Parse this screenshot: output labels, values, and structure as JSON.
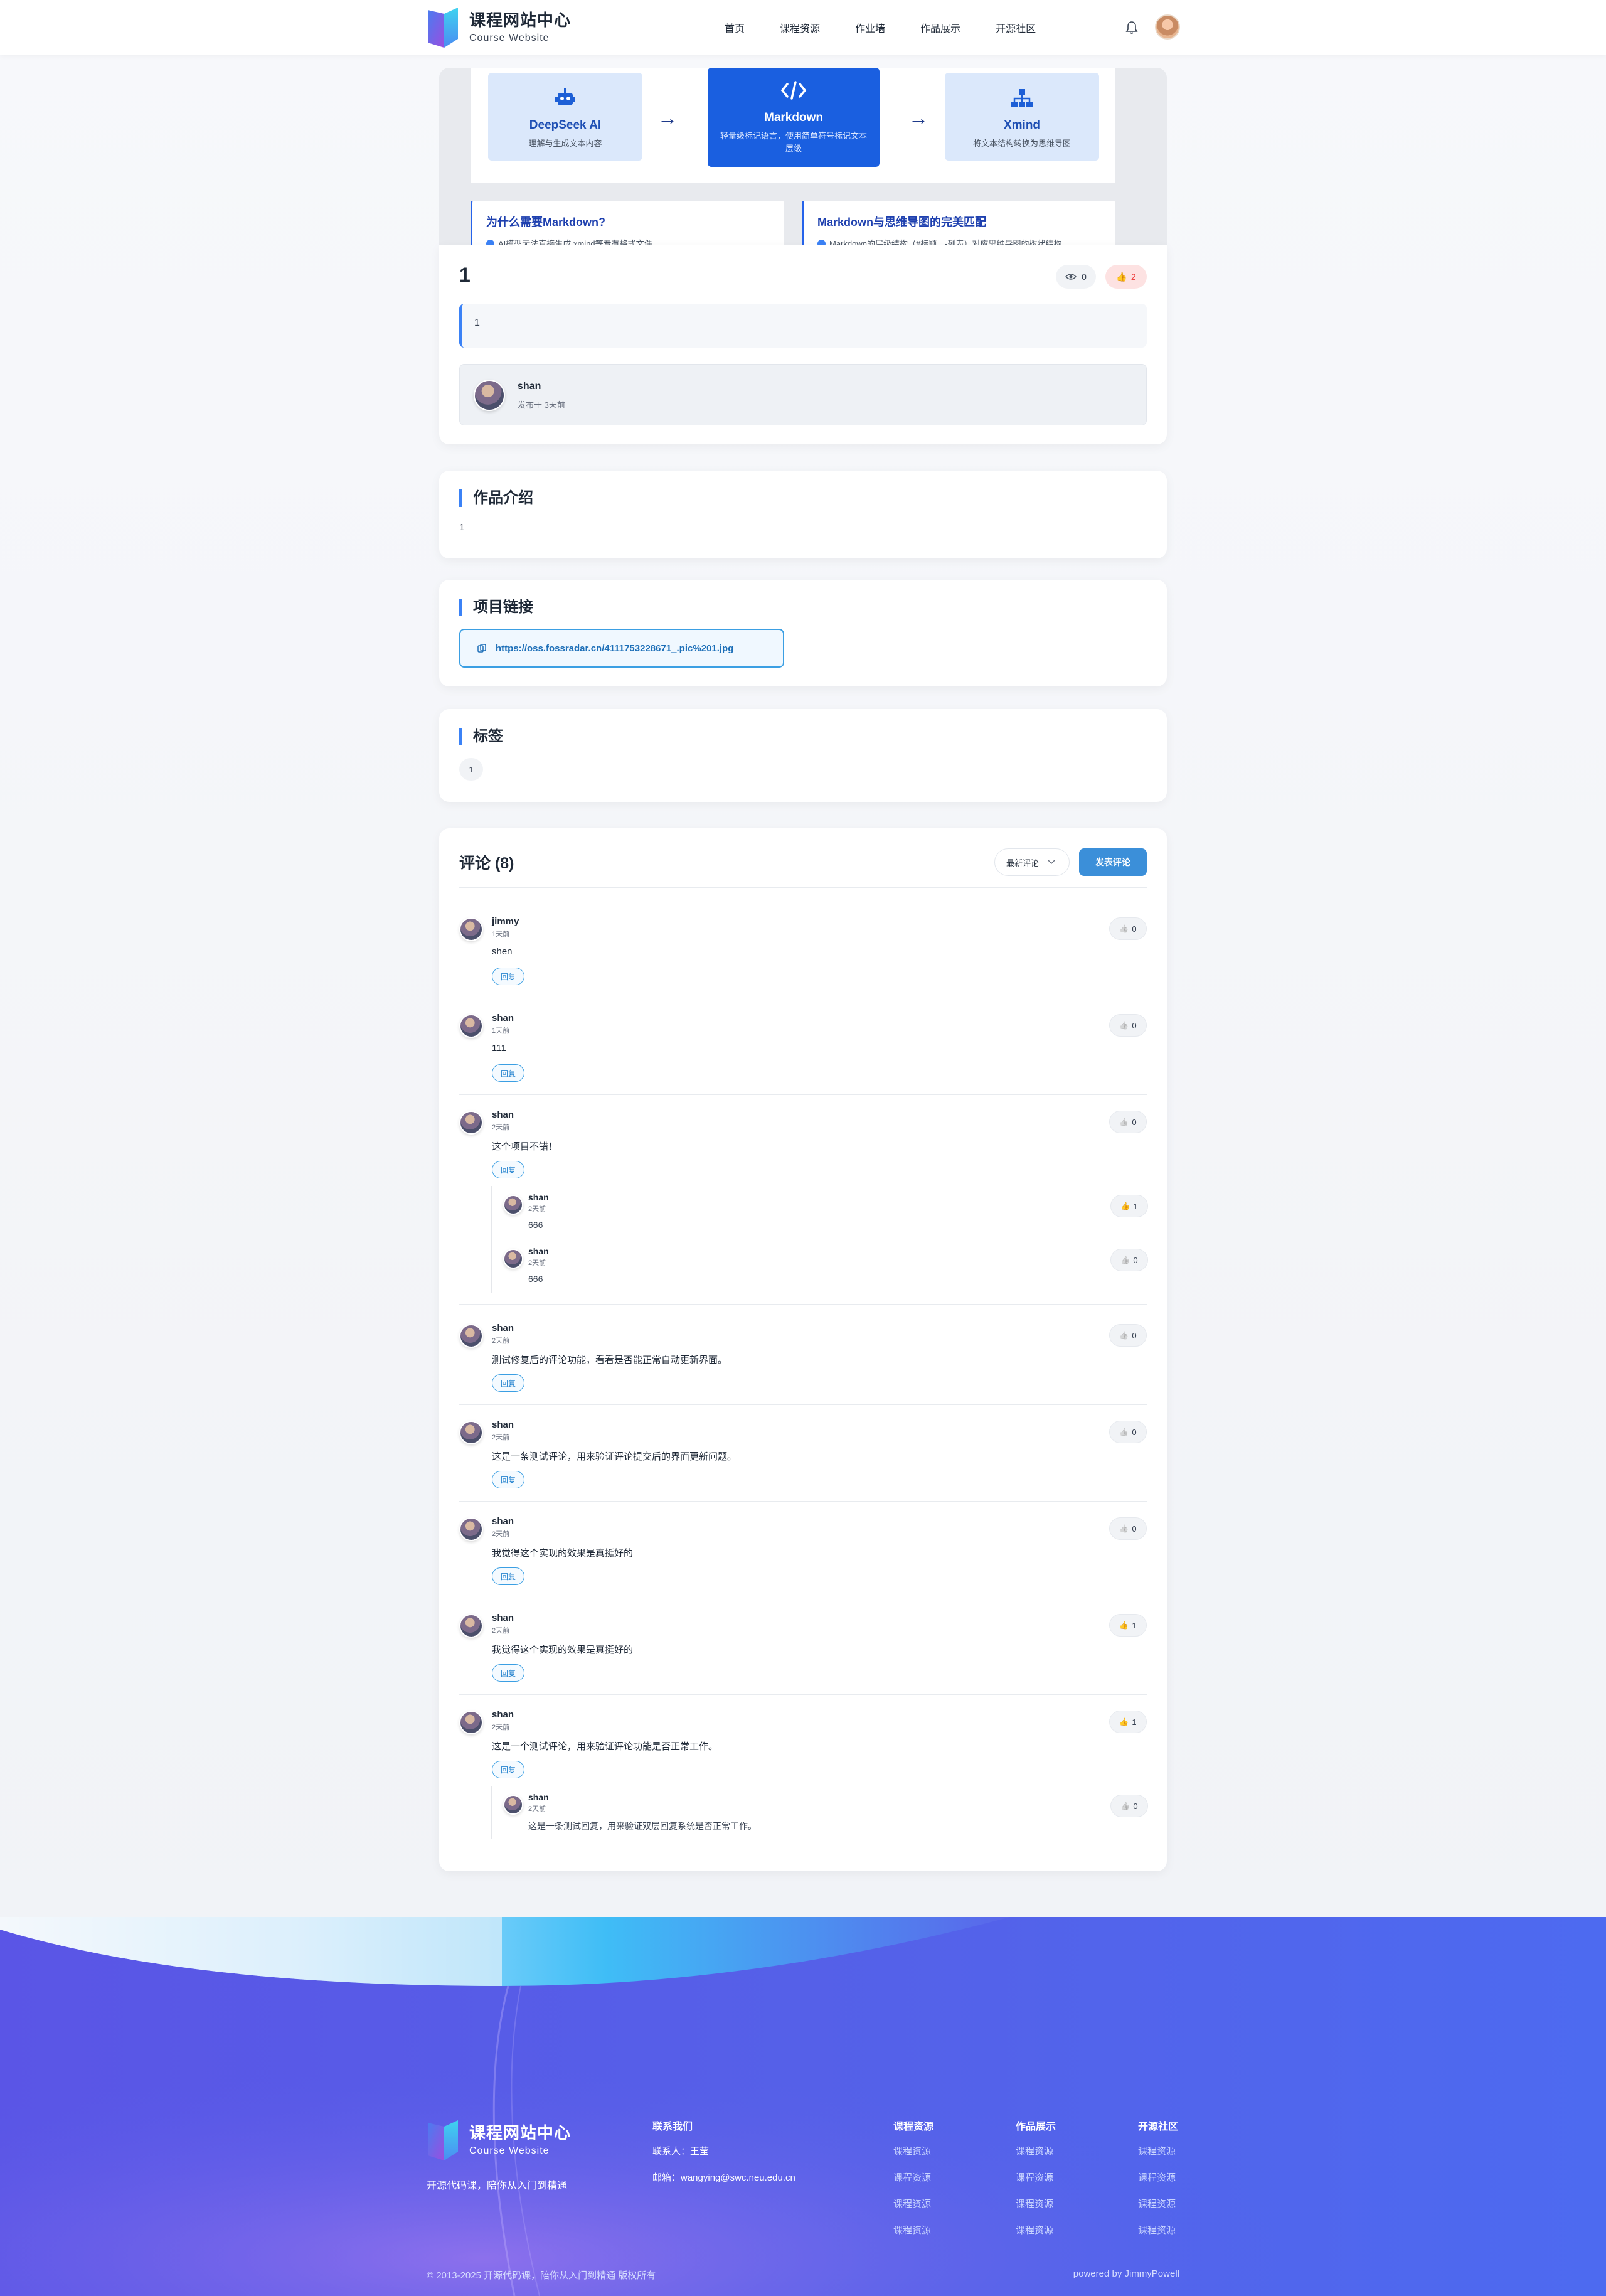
{
  "header": {
    "logo_title": "课程网站中心",
    "logo_sub": "Course Website",
    "nav": [
      "首页",
      "课程资源",
      "作业墙",
      "作品展示",
      "开源社区"
    ]
  },
  "cover": {
    "boxes": [
      {
        "title": "DeepSeek AI",
        "sub": "理解与生成文本内容"
      },
      {
        "title": "Markdown",
        "sub": "轻量级标记语言，使用简单符号标记文本层级"
      },
      {
        "title": "Xmind",
        "sub": "将文本结构转换为思维导图"
      }
    ],
    "why": [
      {
        "title": "为什么需要Markdown?",
        "sub": "AI模型无法直接生成.xmind等专有格式文件"
      },
      {
        "title": "Markdown与思维导图的完美匹配",
        "sub": "Markdown的层级结构（#标题、-列表）对应思维导图的树状结构"
      }
    ]
  },
  "work": {
    "title": "1",
    "views": "0",
    "likes": "2",
    "description": "1",
    "author": "shan",
    "published": "发布于 3天前"
  },
  "intro": {
    "heading": "作品介绍",
    "text": "1"
  },
  "link": {
    "heading": "项目链接",
    "url": "https://oss.fossradar.cn/4111753228671_.pic%201.jpg"
  },
  "tags": {
    "heading": "标签",
    "items": [
      "1"
    ]
  },
  "comments": {
    "heading": "评论 (8)",
    "sort": "最新评论",
    "post_label": "发表评论",
    "reply_label": "回复",
    "items": [
      {
        "name": "jimmy",
        "time": "1天前",
        "text": "shen",
        "likes": "0",
        "liked": false
      },
      {
        "name": "shan",
        "time": "1天前",
        "text": "111",
        "likes": "0",
        "liked": false
      },
      {
        "name": "shan",
        "time": "2天前",
        "text": "这个项目不错！",
        "likes": "0",
        "liked": false,
        "replies": [
          {
            "name": "shan",
            "time": "2天前",
            "text": "666",
            "likes": "1",
            "liked": true
          },
          {
            "name": "shan",
            "time": "2天前",
            "text": "666",
            "likes": "0",
            "liked": false
          }
        ]
      },
      {
        "name": "shan",
        "time": "2天前",
        "text": "测试修复后的评论功能，看看是否能正常自动更新界面。",
        "likes": "0",
        "liked": false
      },
      {
        "name": "shan",
        "time": "2天前",
        "text": "这是一条测试评论，用来验证评论提交后的界面更新问题。",
        "likes": "0",
        "liked": false
      },
      {
        "name": "shan",
        "time": "2天前",
        "text": "我觉得这个实现的效果是真挺好的",
        "likes": "0",
        "liked": false
      },
      {
        "name": "shan",
        "time": "2天前",
        "text": "我觉得这个实现的效果是真挺好的",
        "likes": "1",
        "liked": true
      },
      {
        "name": "shan",
        "time": "2天前",
        "text": "这是一个测试评论，用来验证评论功能是否正常工作。",
        "likes": "1",
        "liked": true,
        "replies": [
          {
            "name": "shan",
            "time": "2天前",
            "text": "这是一条测试回复，用来验证双层回复系统是否正常工作。",
            "likes": "0",
            "liked": false
          }
        ]
      }
    ]
  },
  "footer": {
    "logo_title": "课程网站中心",
    "logo_sub": "Course Website",
    "slogan": "开源代码课，陪你从入门到精通",
    "contact_heading": "联系我们",
    "contact_person": "联系人：王莹",
    "contact_email": "邮箱：wangying@swc.neu.edu.cn",
    "columns": [
      {
        "title": "课程资源",
        "links": [
          "课程资源",
          "课程资源",
          "课程资源",
          "课程资源"
        ]
      },
      {
        "title": "作品展示",
        "links": [
          "课程资源",
          "课程资源",
          "课程资源",
          "课程资源"
        ]
      },
      {
        "title": "开源社区",
        "links": [
          "课程资源",
          "课程资源",
          "课程资源",
          "课程资源"
        ]
      }
    ],
    "copyright": "© 2013-2025 开源代码课，陪你从入门到精通 版权所有",
    "powered": "powered by JimmyPowell"
  },
  "colors": {
    "accent": "#3b82f6",
    "link_border": "#3b9fe3",
    "liked": "#ef4444",
    "footer": "#5560e8"
  }
}
